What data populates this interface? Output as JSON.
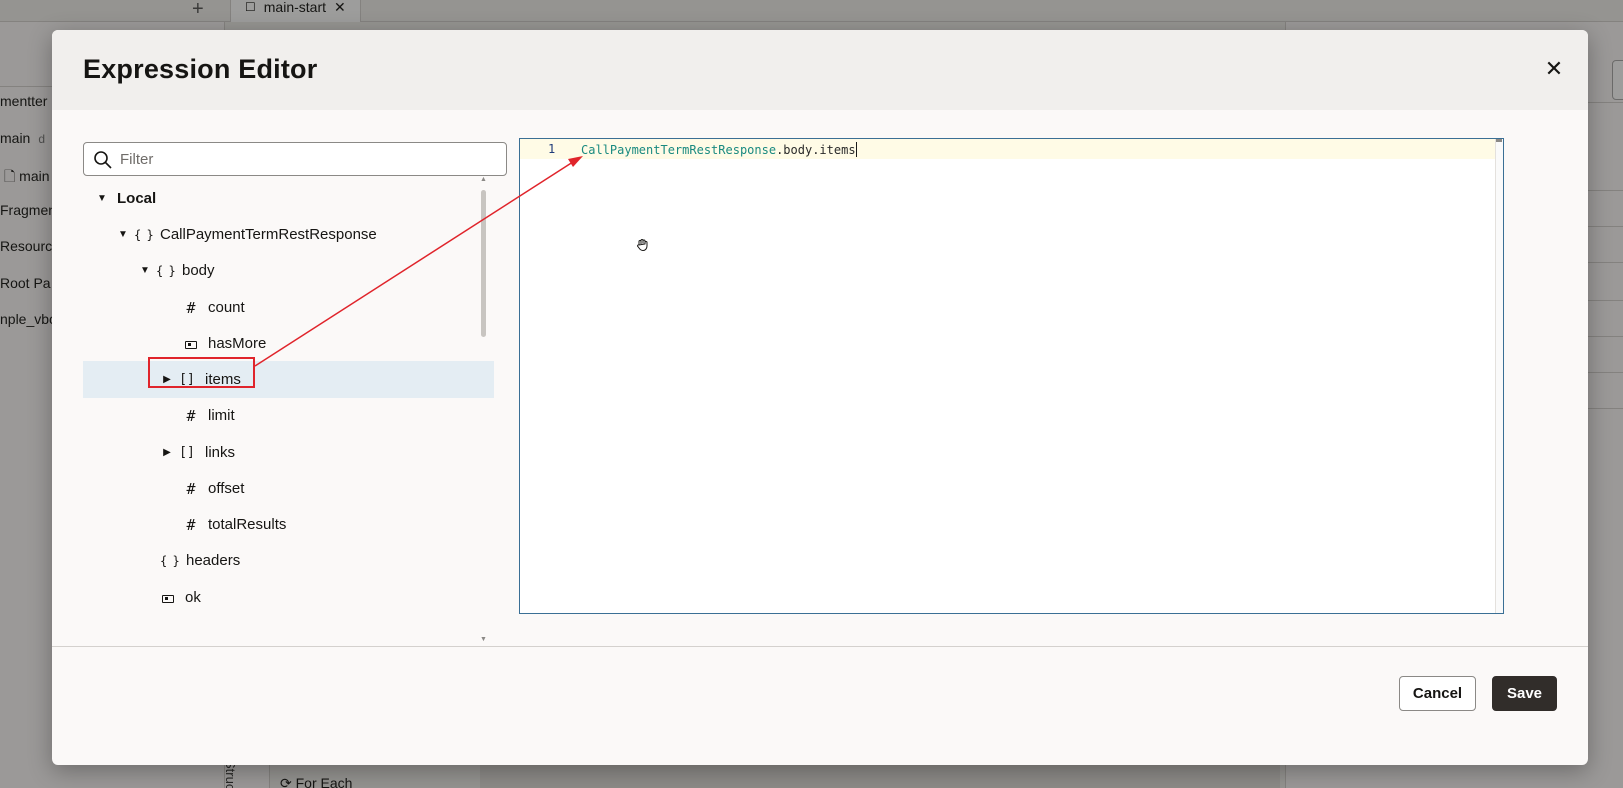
{
  "background": {
    "tab_label": "main-start",
    "left_items": [
      "mentter",
      "main",
      "main",
      "Fragmen",
      "Resourc",
      "Root Pa",
      "nple_vbc"
    ],
    "left_item_suffix": "d",
    "structure_label": "Structure",
    "for_each_label": "For Each"
  },
  "dialog": {
    "title": "Expression Editor",
    "close_icon": "close-icon",
    "filter_placeholder": "Filter",
    "tree": {
      "section": "Local",
      "items": [
        {
          "label": "CallPaymentTermRestResponse",
          "type": "object",
          "expanded": true
        },
        {
          "label": "body",
          "type": "object",
          "expanded": true
        },
        {
          "label": "count",
          "type": "number"
        },
        {
          "label": "hasMore",
          "type": "boolean"
        },
        {
          "label": "items",
          "type": "array",
          "expanded": false,
          "selected": true
        },
        {
          "label": "limit",
          "type": "number"
        },
        {
          "label": "links",
          "type": "array",
          "expanded": false
        },
        {
          "label": "offset",
          "type": "number"
        },
        {
          "label": "totalResults",
          "type": "number"
        },
        {
          "label": "headers",
          "type": "object"
        },
        {
          "label": "ok",
          "type": "boolean"
        }
      ]
    },
    "editor": {
      "line_number": "1",
      "code_identifier": "CallPaymentTermRestResponse",
      "code_rest": ".body.items"
    },
    "buttons": {
      "cancel": "Cancel",
      "save": "Save"
    },
    "colors": {
      "annotation": "#e0242b",
      "selected_row": "#e4edf3",
      "save_button": "#312d2a",
      "editor_border": "#3a6f95"
    }
  }
}
